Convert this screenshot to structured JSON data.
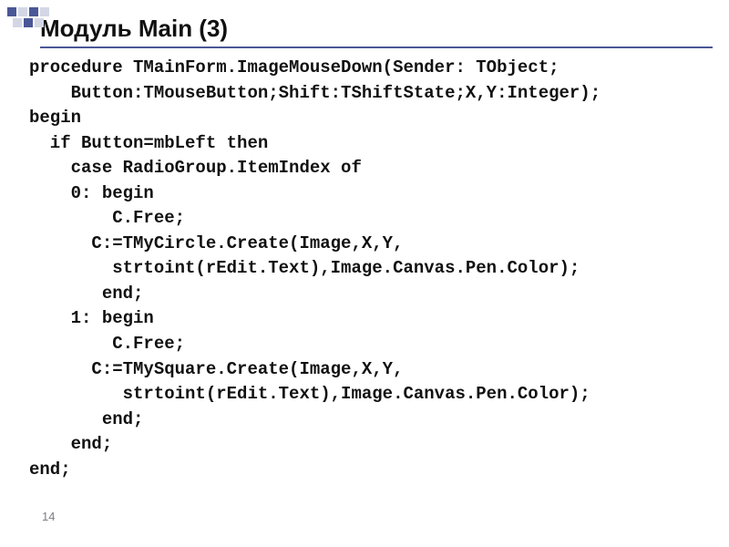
{
  "title": "Модуль Main (3)",
  "code": {
    "l1": "procedure TMainForm.ImageMouseDown(Sender: TObject;",
    "l2": "    Button:TMouseButton;Shift:TShiftState;X,Y:Integer);",
    "l3": "begin",
    "l4": "  if Button=mbLeft then",
    "l5": "    case RadioGroup.ItemIndex of",
    "l6": "    0: begin",
    "l7": "        C.Free;",
    "l8": "      C:=TMyCircle.Create(Image,X,Y,",
    "l9": "        strtoint(rEdit.Text),Image.Canvas.Pen.Color);",
    "l10": "       end;",
    "l11": "    1: begin",
    "l12": "        C.Free;",
    "l13": "      C:=TMySquare.Create(Image,X,Y,",
    "l14": "         strtoint(rEdit.Text),Image.Canvas.Pen.Color);",
    "l15": "       end;",
    "l16": "    end;",
    "l17": "end;"
  },
  "page_number": "14"
}
